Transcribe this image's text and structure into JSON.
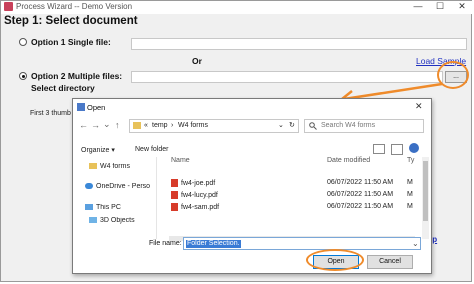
{
  "wizard": {
    "title": "Process Wizard -- Demo Version",
    "controls": {
      "minimize": "—",
      "maximize": "☐",
      "close": "✕"
    },
    "step_title": "Step 1: Select document",
    "option1_label": "Option 1 Single file:",
    "or_label": "Or",
    "load_sample": "Load Sample",
    "option2_label": "Option 2 Multiple files:",
    "select_directory": "Select directory",
    "browse_label": "...",
    "first_thumbnails": "First 3 thumb",
    "help_link": "lp",
    "accent_color": "#ef8b2b"
  },
  "dialog": {
    "title": "Open",
    "close": "✕",
    "nav": {
      "back": "←",
      "forward": "→",
      "down": "⌄",
      "up": "↑"
    },
    "address": {
      "prefix": "«",
      "path1": "temp",
      "sep": "›",
      "path2": "W4 forms",
      "dropdown": "⌄",
      "refresh": "↻"
    },
    "search_placeholder": "Search W4 forms",
    "toolbar": {
      "organize": "Organize ▾",
      "new_folder": "New folder"
    },
    "nav_pane": [
      {
        "label": "W4 forms",
        "icon": "folder-icon"
      },
      {
        "label": "OneDrive - Perso",
        "icon": "cloud-icon"
      },
      {
        "label": "This PC",
        "icon": "computer-icon"
      },
      {
        "label": "3D Objects",
        "icon": "cube-icon"
      }
    ],
    "columns": {
      "name": "Name",
      "date": "Date modified",
      "type": "Ty"
    },
    "files": [
      {
        "name": "fw4-joe.pdf",
        "date": "06/07/2022 11:50 AM",
        "type": "M"
      },
      {
        "name": "fw4-lucy.pdf",
        "date": "06/07/2022 11:50 AM",
        "type": "M"
      },
      {
        "name": "fw4-sam.pdf",
        "date": "06/07/2022 11:50 AM",
        "type": "M"
      }
    ],
    "file_name_label": "File name:",
    "file_name_value": "Folder Selection.",
    "open_button": "Open",
    "cancel_button": "Cancel"
  }
}
